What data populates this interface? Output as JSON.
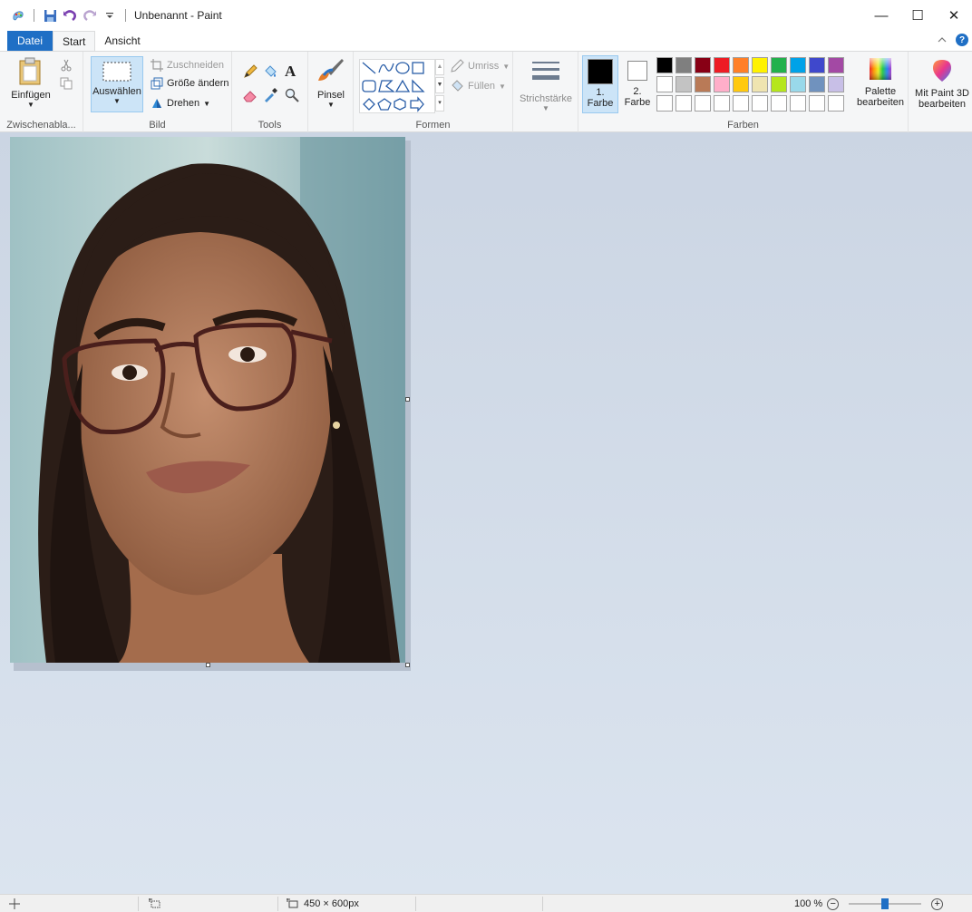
{
  "window": {
    "title": "Unbenannt - Paint",
    "minimize": "—",
    "maximize": "☐",
    "close": "✕"
  },
  "tabs": {
    "file": "Datei",
    "start": "Start",
    "view": "Ansicht"
  },
  "ribbon": {
    "clipboard": {
      "label": "Zwischenabla...",
      "paste": "Einfügen"
    },
    "image": {
      "label": "Bild",
      "select": "Auswählen",
      "crop": "Zuschneiden",
      "resize": "Größe ändern",
      "rotate": "Drehen"
    },
    "tools": {
      "label": "Tools"
    },
    "brush": {
      "label": "Pinsel"
    },
    "shapes": {
      "label": "Formen",
      "outline": "Umriss",
      "fill": "Füllen"
    },
    "stroke": {
      "label": "Strichstärke"
    },
    "colors": {
      "label": "Farben",
      "color1_num": "1.",
      "color1_word": "Farbe",
      "color2_num": "2.",
      "color2_word": "Farbe",
      "edit_palette_1": "Palette",
      "edit_palette_2": "bearbeiten",
      "color1": "#000000",
      "color2": "#ffffff",
      "row1": [
        "#000000",
        "#7f7f7f",
        "#880015",
        "#ed1c24",
        "#ff7f27",
        "#fff200",
        "#22b14c",
        "#00a2e8",
        "#3f48cc",
        "#a349a4"
      ],
      "row2": [
        "#ffffff",
        "#c3c3c3",
        "#b97a57",
        "#ffaec9",
        "#ffc90e",
        "#efe4b0",
        "#b5e61d",
        "#99d9ea",
        "#7092be",
        "#c8bfe7"
      ],
      "row3": [
        "#ffffff",
        "#ffffff",
        "#ffffff",
        "#ffffff",
        "#ffffff",
        "#ffffff",
        "#ffffff",
        "#ffffff",
        "#ffffff",
        "#ffffff"
      ]
    },
    "paint3d": {
      "line1": "Mit Paint 3D",
      "line2": "bearbeiten"
    }
  },
  "status": {
    "size": "450 × 600px",
    "zoom": "100 %",
    "zoom_level_percent": 100
  }
}
